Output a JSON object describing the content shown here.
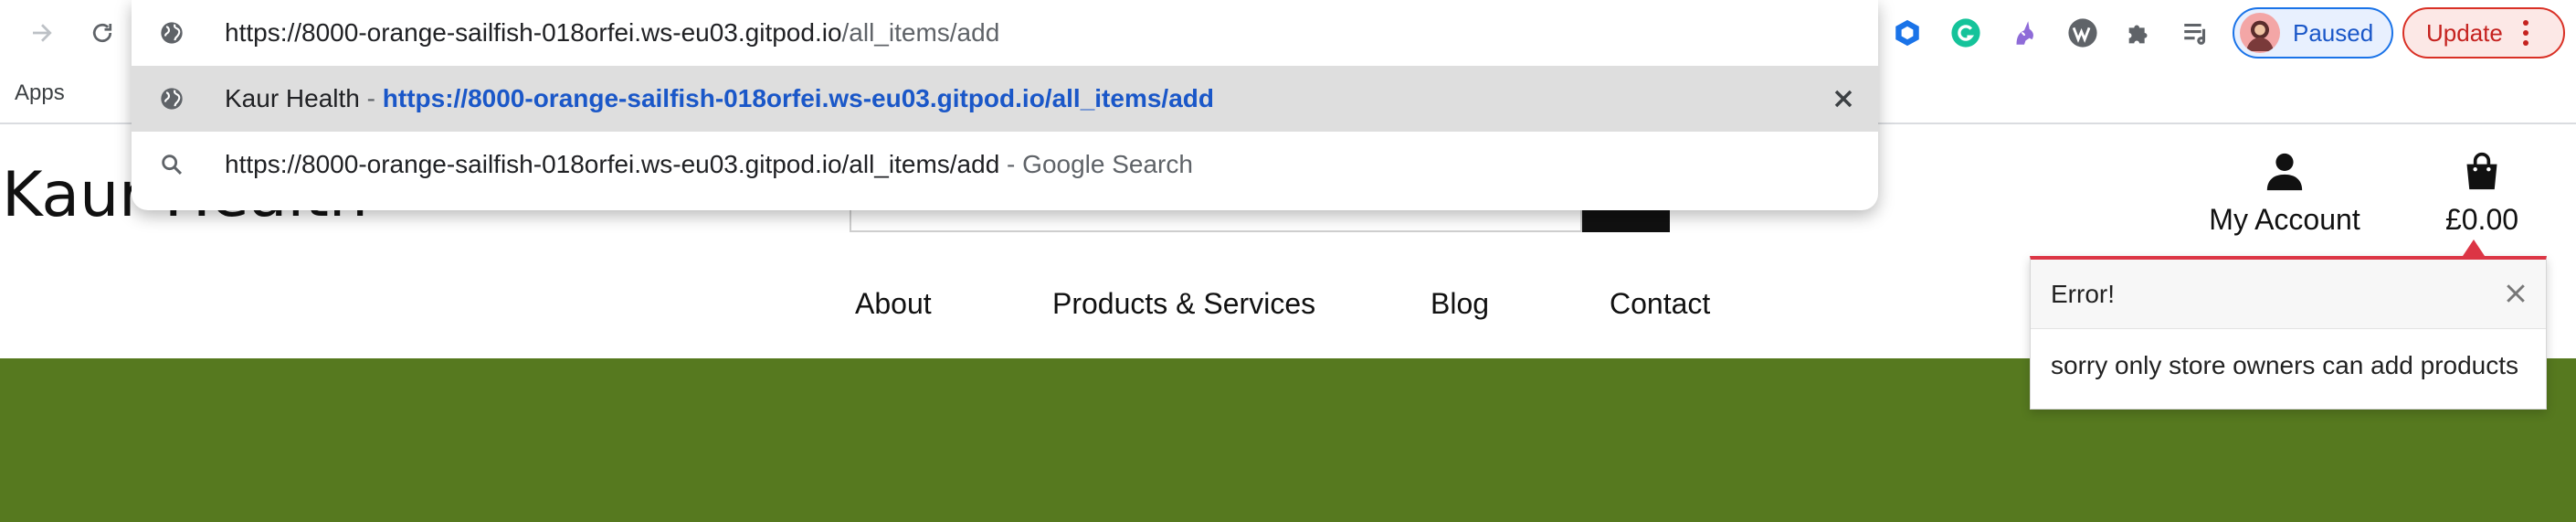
{
  "browser": {
    "omnibox": {
      "input": {
        "host": "https://8000-orange-sailfish-018orfei.ws-eu03.gitpod.io",
        "path": "/all_items/add"
      },
      "suggestions": [
        {
          "title": "Kaur Health",
          "separator": " - ",
          "url": "https://8000-orange-sailfish-018orfei.ws-eu03.gitpod.io/all_items/add",
          "icon": "globe-icon"
        },
        {
          "query": "https://8000-orange-sailfish-018orfei.ws-eu03.gitpod.io/all_items/add",
          "suffix": " - Google Search",
          "icon": "search-icon"
        }
      ]
    },
    "bookmarks": {
      "apps": "Apps"
    },
    "profile": {
      "status": "Paused"
    },
    "update_label": "Update",
    "extensions": [
      "hexagon-extension-icon",
      "grammarly-extension-icon",
      "unicorn-extension-icon",
      "wordpress-extension-icon",
      "puzzle-icon",
      "reading-list-icon"
    ]
  },
  "site": {
    "brand": "Kaur Health",
    "account_label": "My Account",
    "cart_total": "£0.00",
    "nav": [
      "About",
      "Products & Services",
      "Blog",
      "Contact"
    ]
  },
  "toast": {
    "title": "Error!",
    "message": "sorry only store owners can add products"
  },
  "colors": {
    "hero": "#56791f",
    "error_accent": "#dc3545",
    "link": "#1a57c8"
  }
}
